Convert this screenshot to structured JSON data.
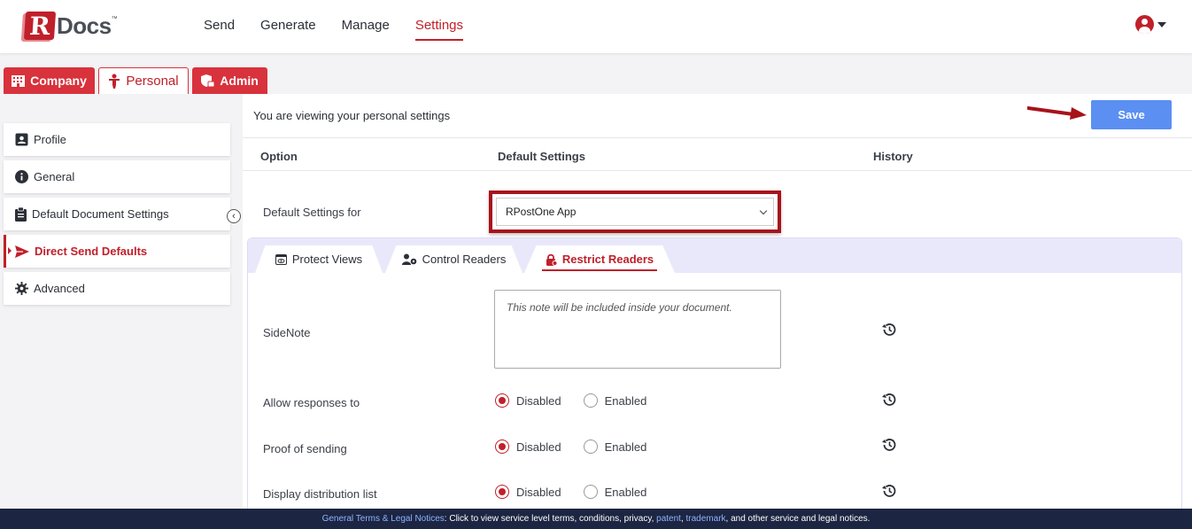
{
  "brand": {
    "logo_letter": "R",
    "logo_word": "Docs",
    "logo_tm": "™"
  },
  "nav": {
    "items": [
      {
        "label": "Send",
        "active": false
      },
      {
        "label": "Generate",
        "active": false
      },
      {
        "label": "Manage",
        "active": false
      },
      {
        "label": "Settings",
        "active": true
      }
    ],
    "user_icon": "user-circle-icon"
  },
  "top_tabs": [
    {
      "label": "Company",
      "icon": "building-icon",
      "active": false
    },
    {
      "label": "Personal",
      "icon": "person-icon",
      "active": true
    },
    {
      "label": "Admin",
      "icon": "shield-lock-icon",
      "active": false
    }
  ],
  "sidebar": {
    "items": [
      {
        "label": "Profile",
        "icon": "id-card-icon",
        "active": false
      },
      {
        "label": "General",
        "icon": "info-icon",
        "active": false
      },
      {
        "label": "Default Document Settings",
        "icon": "clipboard-icon",
        "active": false
      },
      {
        "label": "Direct Send Defaults",
        "icon": "send-icon",
        "active": true
      },
      {
        "label": "Advanced",
        "icon": "gear-icon",
        "active": false
      }
    ],
    "collapse_glyph": "‹"
  },
  "main": {
    "notice": "You are viewing your personal settings",
    "save_label": "Save",
    "columns": {
      "option": "Option",
      "default": "Default Settings",
      "history": "History"
    },
    "default_for": {
      "label": "Default Settings for",
      "value": "RPostOne App"
    },
    "sub_tabs": [
      {
        "label": "Protect Views",
        "icon": "eye-window-icon",
        "active": false
      },
      {
        "label": "Control Readers",
        "icon": "users-gear-icon",
        "active": false
      },
      {
        "label": "Restrict Readers",
        "icon": "lock-icon",
        "active": true
      }
    ],
    "sidenote": {
      "label": "SideNote",
      "placeholder": "This note will be included inside your document."
    },
    "options": [
      {
        "label": "Allow responses to",
        "selected": "Disabled",
        "choices": [
          "Disabled",
          "Enabled"
        ]
      },
      {
        "label": "Proof of sending",
        "selected": "Disabled",
        "choices": [
          "Disabled",
          "Enabled"
        ]
      },
      {
        "label": "Display distribution list",
        "selected": "Disabled",
        "choices": [
          "Disabled",
          "Enabled"
        ]
      }
    ]
  },
  "footer": {
    "link1": "General Terms & Legal Notices",
    "text1": ": Click to view service level terms, conditions, privacy, ",
    "link2": "patent",
    "sep": ", ",
    "link3": "trademark",
    "text2": ", and other service and legal notices."
  },
  "colors": {
    "brand_red": "#c0202a",
    "save_blue": "#5b8ff2",
    "footer_bg": "#1c2541"
  }
}
